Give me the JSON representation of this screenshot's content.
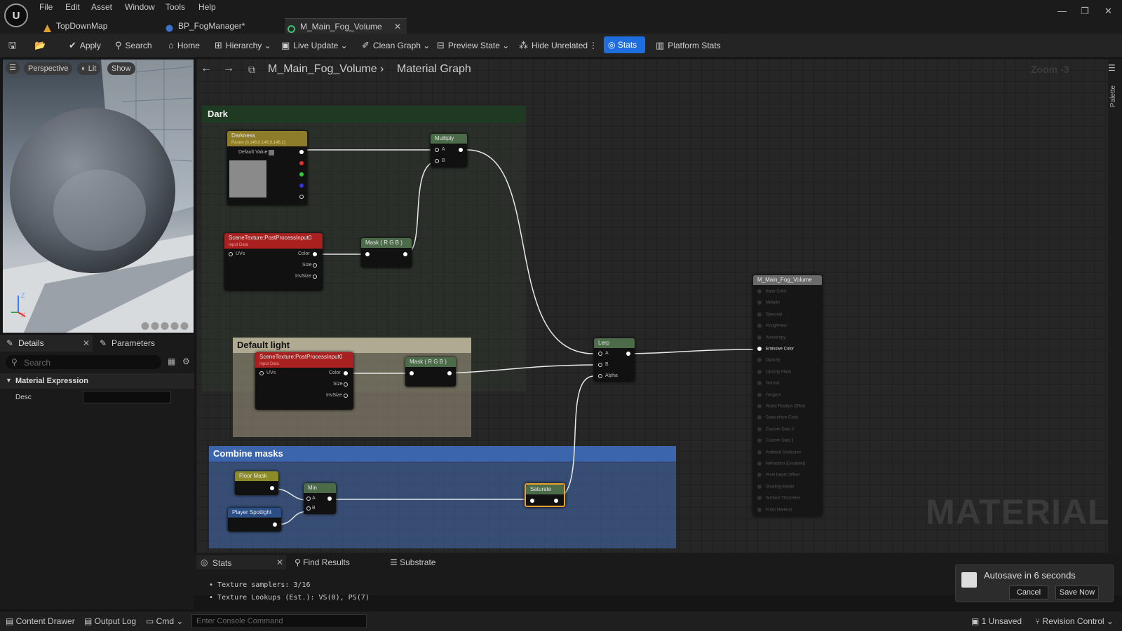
{
  "menu": [
    "File",
    "Edit",
    "Asset",
    "Window",
    "Tools",
    "Help"
  ],
  "tabs": [
    {
      "label": "TopDownMap",
      "icon": "map-icon"
    },
    {
      "label": "BP_FogManager*",
      "icon": "blueprint-icon"
    },
    {
      "label": "M_Main_Fog_Volume",
      "icon": "material-icon"
    }
  ],
  "toolbar": {
    "apply": "Apply",
    "search": "Search",
    "home": "Home",
    "hierarchy": "Hierarchy",
    "live_update": "Live Update",
    "clean_graph": "Clean Graph",
    "preview_state": "Preview State",
    "hide_unrelated": "Hide Unrelated",
    "stats": "Stats",
    "platform_stats": "Platform Stats"
  },
  "viewport": {
    "perspective": "Perspective",
    "lit": "Lit",
    "show": "Show",
    "axis_z": "Z",
    "axis_x": "X"
  },
  "details": {
    "tab_details": "Details",
    "tab_parameters": "Parameters",
    "search_placeholder": "Search",
    "section": "Material Expression",
    "desc_label": "Desc",
    "desc_value": ""
  },
  "graph": {
    "breadcrumb_asset": "M_Main_Fog_Volume",
    "breadcrumb_graph": "Material Graph",
    "zoom": "Zoom -3",
    "palette": "Palette",
    "watermark": "MATERIAL",
    "comments": {
      "dark": "Dark",
      "default_light": "Default light",
      "combine": "Combine masks"
    },
    "nodes": {
      "darkness": {
        "title": "Darkness",
        "sub": "Param (0.146,0.146,0.146,1)",
        "default_value": "Default Value"
      },
      "scene1": {
        "title": "SceneTexture:PostProcessInput0",
        "sub": "Input Data",
        "uvs": "UVs",
        "color": "Color",
        "size": "Size",
        "invsize": "InvSize"
      },
      "scene2": {
        "title": "SceneTexture:PostProcessInput0",
        "sub": "Input Data",
        "uvs": "UVs",
        "color": "Color",
        "size": "Size",
        "invsize": "InvSize"
      },
      "mask1": "Mask ( R G B )",
      "mask2": "Mask ( R G B )",
      "multiply": {
        "title": "Multiply",
        "a": "A",
        "b": "B"
      },
      "lerp": {
        "title": "Lerp",
        "a": "A",
        "b": "B",
        "alpha": "Alpha"
      },
      "floor": "Floor Mask",
      "spot": "Player Spotlight",
      "min": {
        "title": "Min",
        "a": "A",
        "b": "B"
      },
      "saturate": "Saturate",
      "result": {
        "title": "M_Main_Fog_Volume",
        "pins": [
          "Base Color",
          "Metallic",
          "Specular",
          "Roughness",
          "Anisotropy",
          "Emissive Color",
          "Opacity",
          "Opacity Mask",
          "Normal",
          "Tangent",
          "World Position Offset",
          "Subsurface Color",
          "Custom Data 0",
          "Custom Data 1",
          "Ambient Occlusion",
          "Refraction (Disabled)",
          "Pixel Depth Offset",
          "Shading Model",
          "Surface Thickness",
          "Front Material"
        ]
      }
    }
  },
  "bottom": {
    "tab_stats": "Stats",
    "tab_find": "Find Results",
    "tab_substrate": "Substrate",
    "lines": [
      "Texture samplers: 3/16",
      "Texture Lookups (Est.): VS(0), PS(7)"
    ]
  },
  "autosave": {
    "title": "Autosave in 6 seconds",
    "cancel": "Cancel",
    "save": "Save Now"
  },
  "status": {
    "content_drawer": "Content Drawer",
    "output_log": "Output Log",
    "cmd": "Cmd",
    "console_placeholder": "Enter Console Command",
    "unsaved": "1 Unsaved",
    "revision": "Revision Control"
  }
}
